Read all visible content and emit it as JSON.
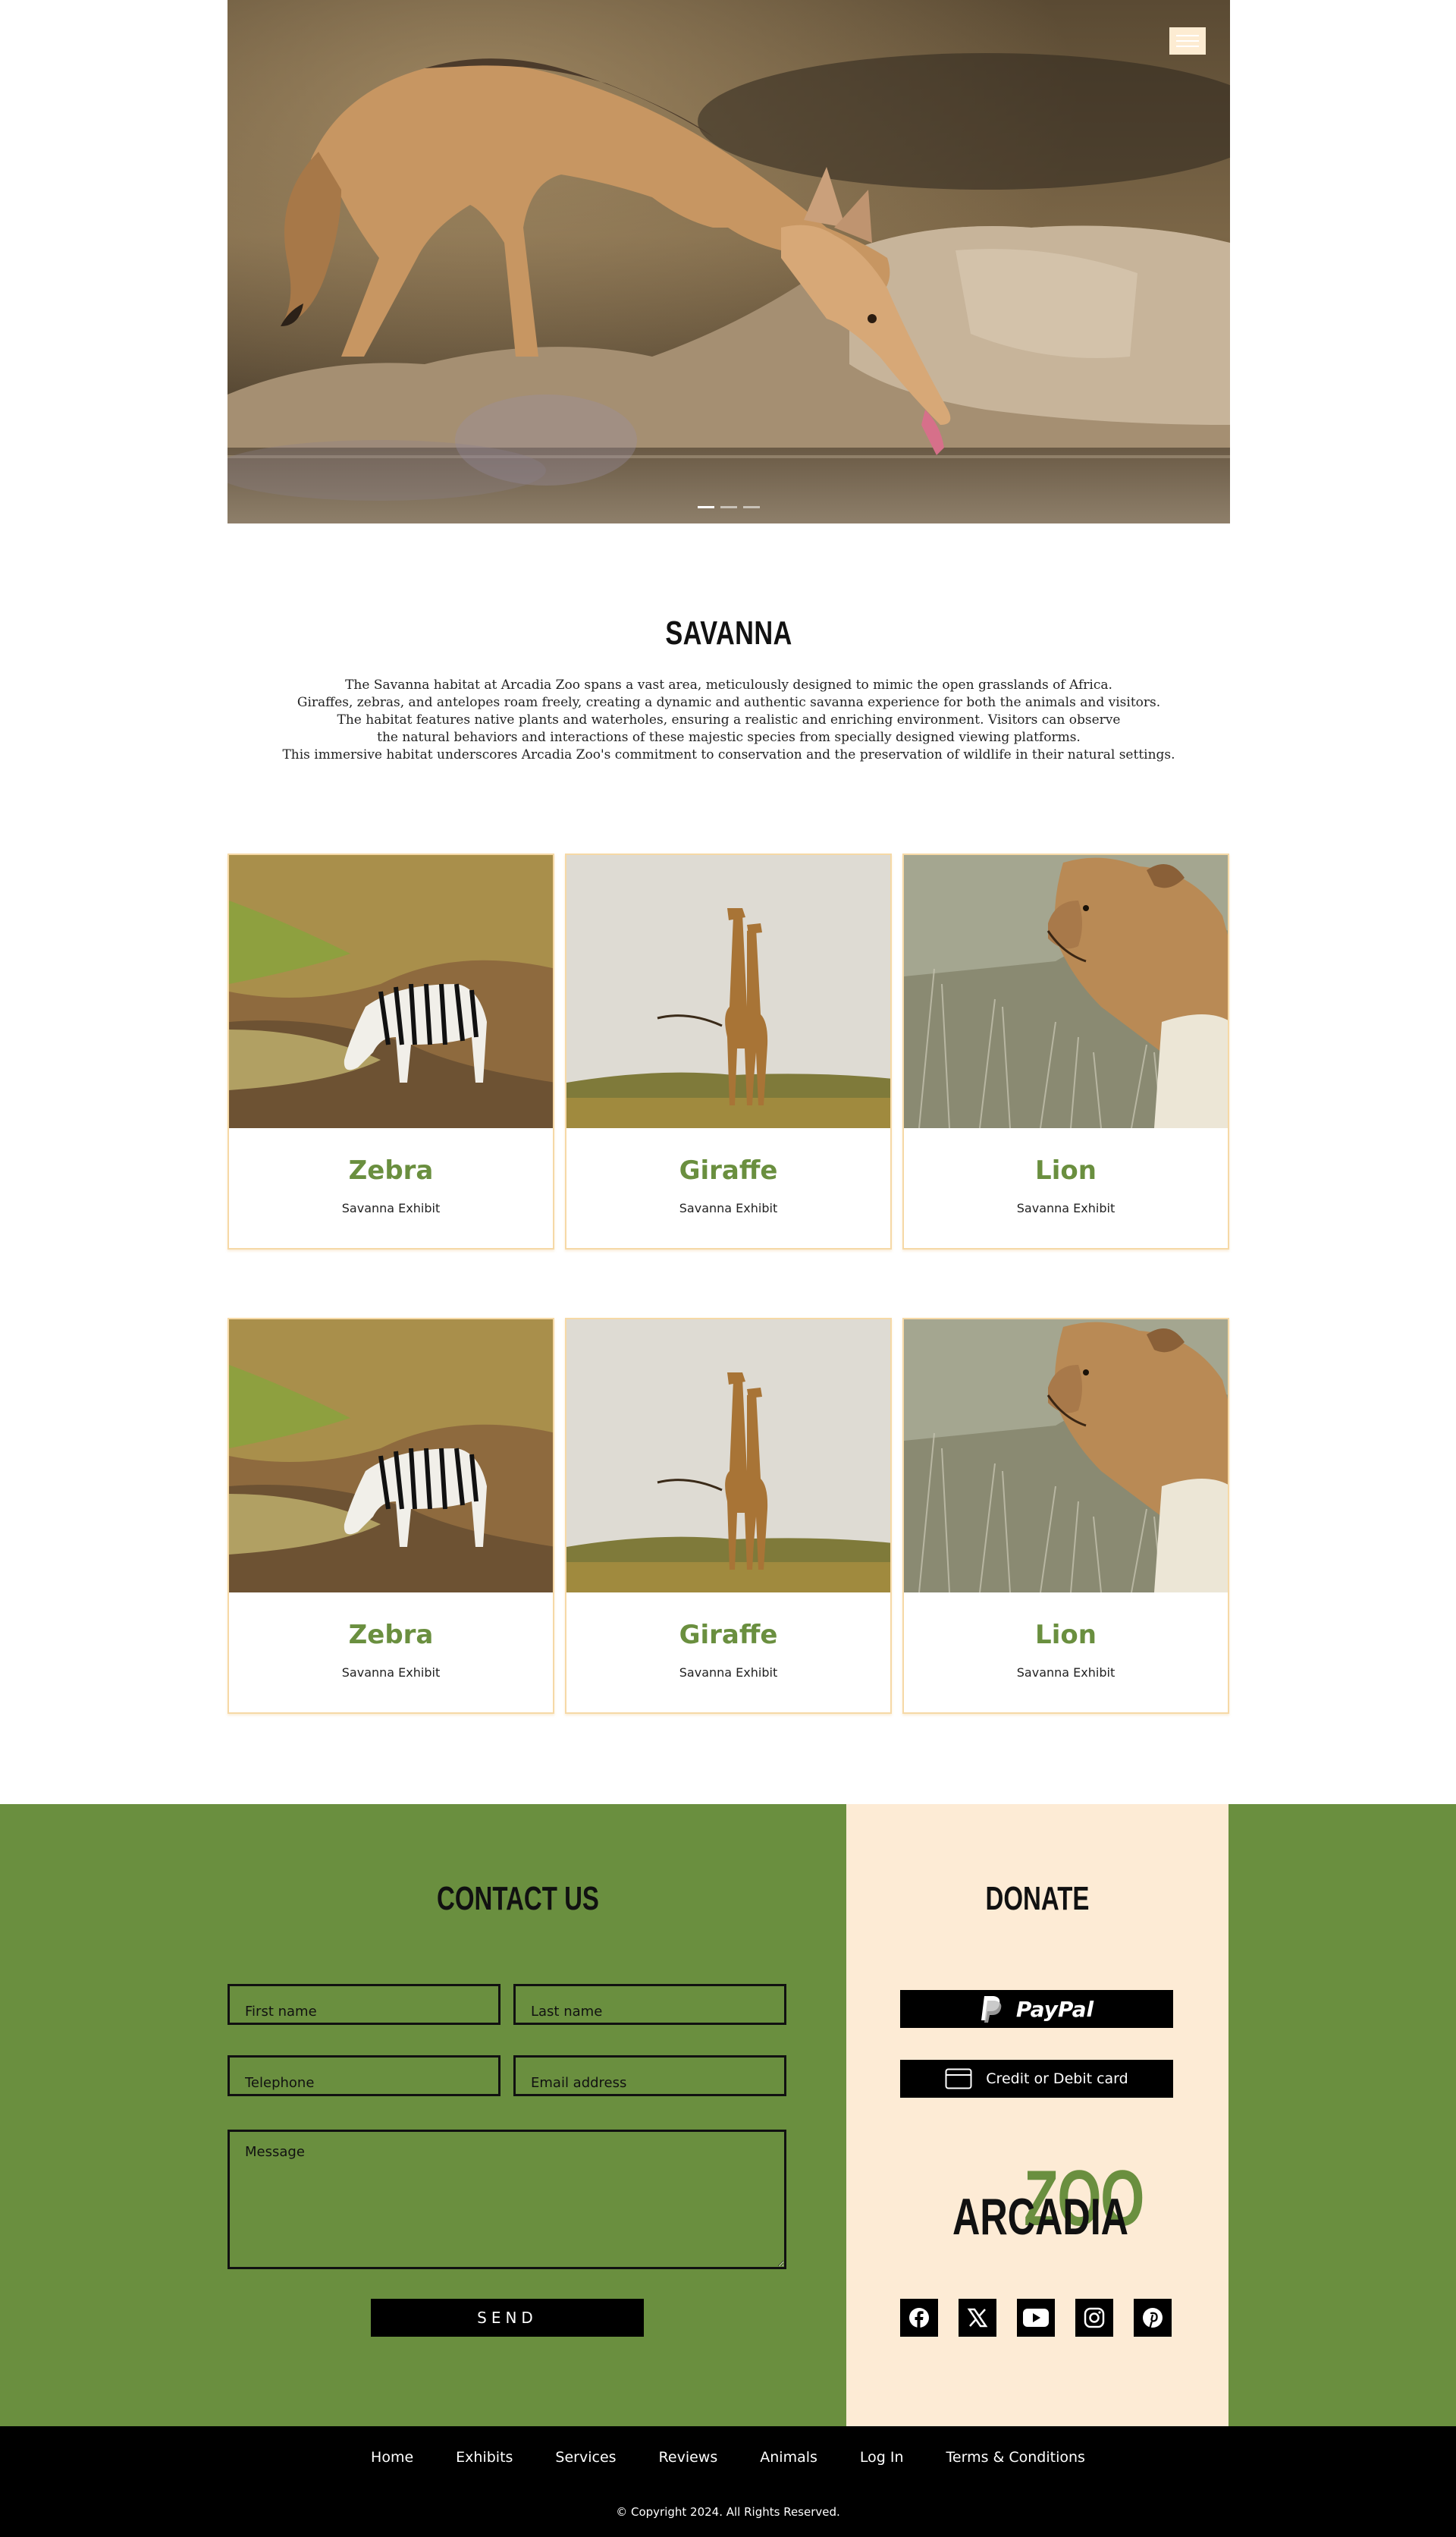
{
  "hero": {
    "menu_icon": "hamburger-icon",
    "slides": 3,
    "active_slide": 1
  },
  "intro": {
    "title": "SAVANNA",
    "lines": [
      "The Savanna habitat at Arcadia Zoo spans a vast area, meticulously designed to mimic the open grasslands of Africa.",
      "Giraffes, zebras, and antelopes roam freely, creating a dynamic and authentic savanna experience for both the animals and visitors.",
      "The habitat features native plants and waterholes, ensuring a realistic and enriching environment. Visitors can observe",
      "the natural behaviors and interactions of these majestic species from specially designed viewing platforms.",
      "This immersive habitat underscores Arcadia Zoo's commitment to conservation and the preservation of wildlife in their natural settings."
    ]
  },
  "animals": [
    {
      "name": "Zebra",
      "exhibit": "Savanna Exhibit"
    },
    {
      "name": "Giraffe",
      "exhibit": "Savanna Exhibit"
    },
    {
      "name": "Lion",
      "exhibit": "Savanna Exhibit"
    },
    {
      "name": "Zebra",
      "exhibit": "Savanna Exhibit"
    },
    {
      "name": "Giraffe",
      "exhibit": "Savanna Exhibit"
    },
    {
      "name": "Lion",
      "exhibit": "Savanna Exhibit"
    }
  ],
  "contact": {
    "title": "CONTACT US",
    "first_name_placeholder": "First name",
    "last_name_placeholder": "Last name",
    "telephone_placeholder": "Telephone",
    "email_placeholder": "Email address",
    "message_placeholder": "Message",
    "send_label": "SEND"
  },
  "donate": {
    "title": "DONATE",
    "paypal_label": "PayPal",
    "card_label": "Credit or Debit card"
  },
  "logo": {
    "part1": "ARCADIA",
    "part2": "ZOO"
  },
  "socials": [
    "facebook-icon",
    "x-icon",
    "youtube-icon",
    "instagram-icon",
    "pinterest-icon"
  ],
  "nav": [
    "Home",
    "Exhibits",
    "Services",
    "Reviews",
    "Animals",
    "Log In",
    "Terms & Conditions"
  ],
  "copyright": "© Copyright 2024. All Rights Reserved.",
  "colors": {
    "brand_green": "#6a8f3f",
    "cream": "#fdebd5",
    "card_border": "#f6d9a6",
    "black": "#000000"
  }
}
